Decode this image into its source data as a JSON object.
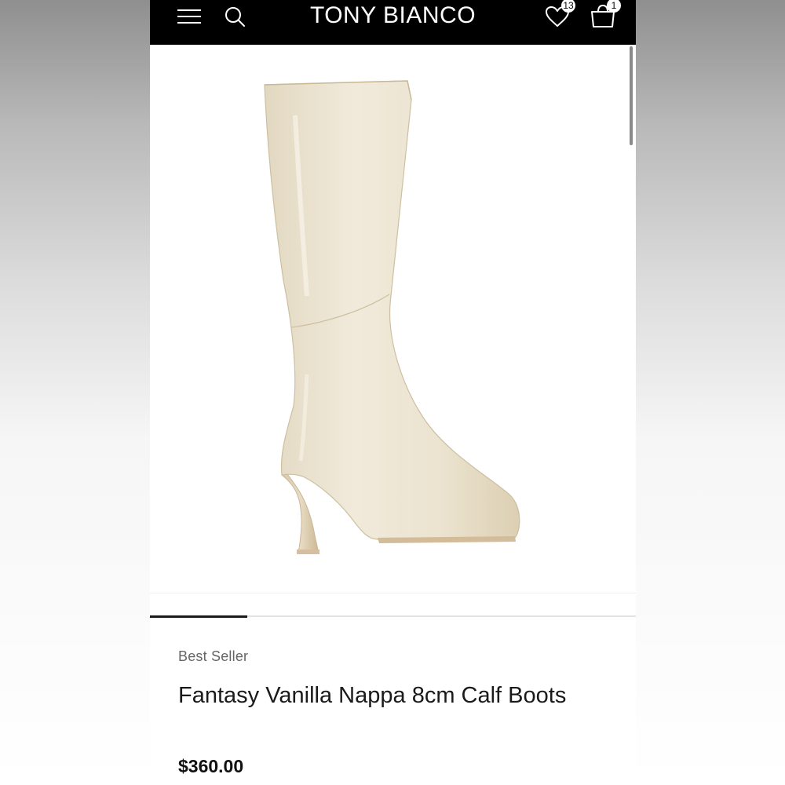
{
  "header": {
    "brand": "TONY BIANCO",
    "wishlist_count": "13",
    "bag_count": "1",
    "icons": [
      "menu-icon",
      "search-icon",
      "heart-icon",
      "bag-icon"
    ]
  },
  "product": {
    "image": "boot-image",
    "badge": "Best Seller",
    "name": "Fantasy Vanilla Nappa 8cm Calf Boots",
    "price": "$360.00"
  },
  "carousel": {
    "current_index": 1
  },
  "colors": {
    "header_bg": "#000000",
    "boot_cream": "#ede5d1",
    "text_primary": "#1a1a1a",
    "text_muted": "#666666"
  }
}
